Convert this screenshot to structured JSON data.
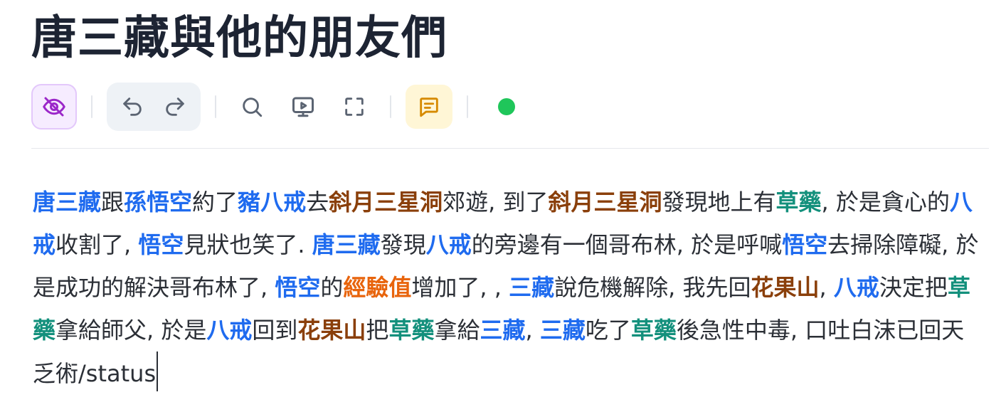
{
  "document": {
    "title": "唐三藏與他的朋友們"
  },
  "colors": {
    "person": "#1f6bef",
    "place": "#8a3f0a",
    "item": "#13907c",
    "stat": "#e8640c",
    "status_online": "#1fc65a"
  },
  "toolbar": {
    "icons": [
      "eye-off-icon",
      "undo-icon",
      "redo-icon",
      "search-icon",
      "present-icon",
      "fullscreen-icon",
      "comment-icon"
    ],
    "status": "online"
  },
  "content": {
    "segments": [
      {
        "text": "唐三藏",
        "type": "person"
      },
      {
        "text": "跟",
        "type": "plain"
      },
      {
        "text": "孫悟空",
        "type": "person"
      },
      {
        "text": "約了",
        "type": "plain"
      },
      {
        "text": "豬八戒",
        "type": "person"
      },
      {
        "text": "去",
        "type": "plain"
      },
      {
        "text": "斜月三星洞",
        "type": "place"
      },
      {
        "text": "郊遊, 到了",
        "type": "plain"
      },
      {
        "text": "斜月三星洞",
        "type": "place"
      },
      {
        "text": "發現地上有",
        "type": "plain"
      },
      {
        "text": "草藥",
        "type": "item"
      },
      {
        "text": ", 於是貪心的",
        "type": "plain"
      },
      {
        "text": "八戒",
        "type": "person"
      },
      {
        "text": "收割了, ",
        "type": "plain"
      },
      {
        "text": "悟空",
        "type": "person"
      },
      {
        "text": "見狀也笑了. ",
        "type": "plain"
      },
      {
        "text": "唐三藏",
        "type": "person"
      },
      {
        "text": "發現",
        "type": "plain"
      },
      {
        "text": "八戒",
        "type": "person"
      },
      {
        "text": "的旁邊有一個哥布林, 於是呼喊",
        "type": "plain"
      },
      {
        "text": "悟空",
        "type": "person"
      },
      {
        "text": "去掃除障礙, 於是成功的解決哥布林了, ",
        "type": "plain"
      },
      {
        "text": "悟空",
        "type": "person"
      },
      {
        "text": "的",
        "type": "plain"
      },
      {
        "text": "經驗值",
        "type": "stat"
      },
      {
        "text": "增加了, , ",
        "type": "plain"
      },
      {
        "text": "三藏",
        "type": "person"
      },
      {
        "text": "說危機解除, 我先回",
        "type": "plain"
      },
      {
        "text": "花果山",
        "type": "place"
      },
      {
        "text": ", ",
        "type": "plain"
      },
      {
        "text": "八戒",
        "type": "person"
      },
      {
        "text": "決定把",
        "type": "plain"
      },
      {
        "text": "草藥",
        "type": "item"
      },
      {
        "text": "拿給師父, 於是",
        "type": "plain"
      },
      {
        "text": "八戒",
        "type": "person"
      },
      {
        "text": "回到",
        "type": "plain"
      },
      {
        "text": "花果山",
        "type": "place"
      },
      {
        "text": "把",
        "type": "plain"
      },
      {
        "text": "草藥",
        "type": "item"
      },
      {
        "text": "拿給",
        "type": "plain"
      },
      {
        "text": "三藏",
        "type": "person"
      },
      {
        "text": ", ",
        "type": "plain"
      },
      {
        "text": "三藏",
        "type": "person"
      },
      {
        "text": "吃了",
        "type": "plain"
      },
      {
        "text": "草藥",
        "type": "item"
      },
      {
        "text": "後急性中毒, 口吐白沫已回天乏術/status",
        "type": "plain"
      }
    ]
  }
}
